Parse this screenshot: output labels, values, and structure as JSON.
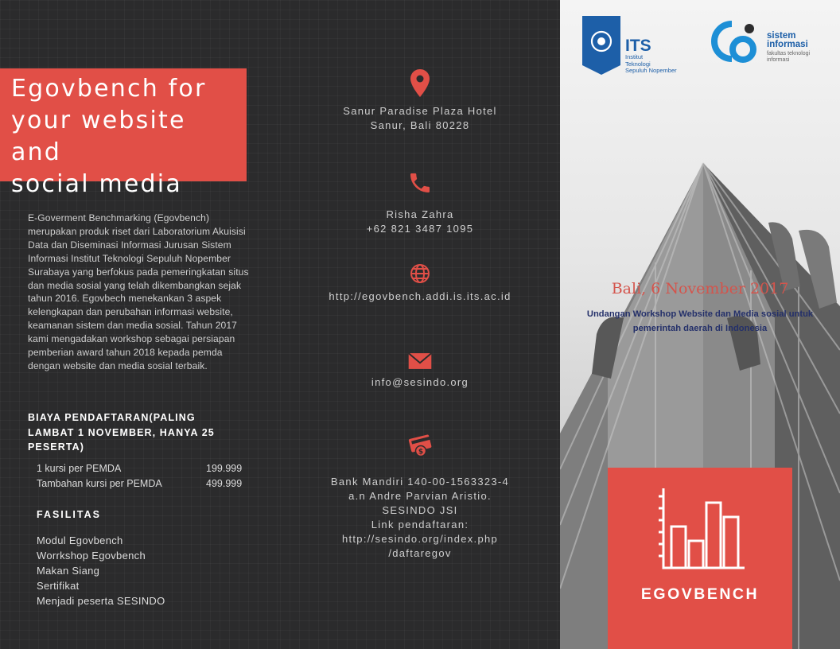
{
  "left": {
    "title": [
      "Egovbench for",
      "your website and",
      "social media"
    ],
    "description": "E-Goverment  Benchmarking (Egovbench) merupakan produk riset dari  Laboratorium Akuisisi Data dan Diseminasi Informasi Jurusan Sistem Informasi Institut Teknologi Sepuluh Nopember Surabaya yang berfokus pada pemeringkatan situs dan media sosial yang telah dikembangkan sejak tahun 2016. Egovbech menekankan 3 aspek kelengkapan dan perubahan informasi website, keamanan sistem dan media sosial. Tahun 2017 kami mengadakan workshop sebagai persiapan pemberian award tahun 2018 kepada pemda dengan website dan media sosial terbaik.",
    "fee_heading": [
      "BIAYA PENDAFTARAN(PALING",
      "LAMBAT 1 NOVEMBER, HANYA 25",
      "PESERTA)"
    ],
    "fees": [
      {
        "label": "1 kursi per PEMDA",
        "value": "199.999"
      },
      {
        "label": "Tambahan kursi per PEMDA",
        "value": "499.999"
      }
    ],
    "facilities_heading": "FASILITAS",
    "facilities": [
      "Modul Egovbench",
      "Worrkshop Egovbench",
      "Makan Siang",
      "Sertifikat",
      "Menjadi peserta SESINDO"
    ]
  },
  "middle": {
    "location": [
      "Sanur Paradise Plaza Hotel",
      "Sanur, Bali 80228"
    ],
    "contact": [
      "Risha Zahra",
      "+62 821 3487 1095"
    ],
    "website": "http://egovbench.addi.is.its.ac.id",
    "email": "info@sesindo.org",
    "payment": [
      "Bank Mandiri 140-00-1563323-4",
      "a.n Andre Parvian Aristio.",
      "SESINDO JSI",
      "Link pendaftaran:",
      "http://sesindo.org/index.php",
      "/daftaregov"
    ],
    "icons": [
      "map-pin-icon",
      "phone-icon",
      "globe-icon",
      "envelope-icon",
      "payment-card-icon"
    ],
    "accent": "#e14f47"
  },
  "right": {
    "its_logo": {
      "name": "ITS",
      "lines": [
        "Institut",
        "Teknologi",
        "Sepuluh Nopember"
      ]
    },
    "si_logo": {
      "name": [
        "sistem",
        "informasi"
      ],
      "lines": [
        "fakultas teknologi",
        "informasi"
      ]
    },
    "event_date": "Bali, 6 November 2017",
    "event_subtitle": [
      "Undangan Workshop Website dan Media sosial untuk",
      "pemerintah daerah di Indonesia"
    ],
    "brand": "EGOVBENCH",
    "brand_icon": "bar-chart-icon",
    "colors": {
      "brand_red": "#e14f47",
      "navy": "#24306a",
      "logo_blue": "#1d5fa8"
    }
  }
}
